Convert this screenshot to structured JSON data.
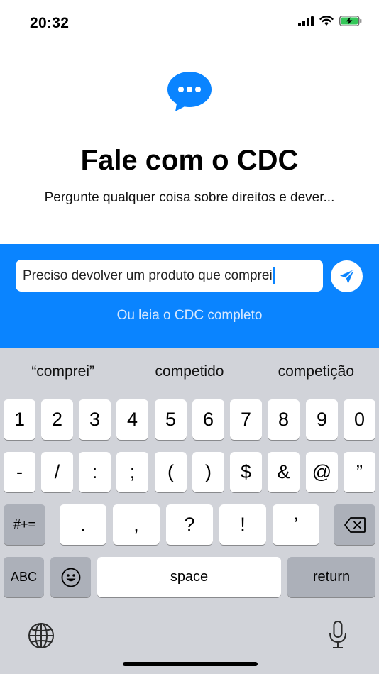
{
  "status_bar": {
    "time": "20:32",
    "signal_icon": "cellular-signal-icon",
    "wifi_icon": "wifi-icon",
    "battery_icon": "battery-charging-icon"
  },
  "hero": {
    "icon": "chat-bubble-icon",
    "title": "Fale com o CDC",
    "subtitle": "Pergunte qualquer coisa sobre direitos e dever..."
  },
  "composer": {
    "input_value": "Preciso devolver um produto que comprei",
    "send_icon": "send-icon",
    "read_link": "Ou leia o CDC completo"
  },
  "keyboard": {
    "suggestions": [
      "“comprei”",
      "competido",
      "competição"
    ],
    "row1": [
      "1",
      "2",
      "3",
      "4",
      "5",
      "6",
      "7",
      "8",
      "9",
      "0"
    ],
    "row2": [
      "-",
      "/",
      ":",
      ";",
      "(",
      ")",
      "$",
      "&",
      "@",
      "”"
    ],
    "row3_switch": "#+=",
    "row3": [
      ".",
      ",",
      "?",
      "!",
      "’"
    ],
    "backspace_icon": "backspace-icon",
    "abc": "ABC",
    "emoji_icon": "emoji-icon",
    "space": "space",
    "return": "return",
    "globe_icon": "globe-icon",
    "mic_icon": "microphone-icon"
  },
  "colors": {
    "accent": "#0a84ff",
    "keyboard_bg": "#d1d3d9",
    "battery": "#34c759"
  }
}
